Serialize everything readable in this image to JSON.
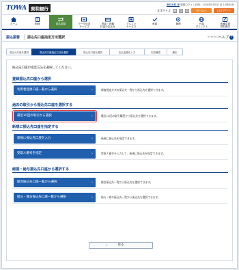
{
  "header": {
    "logo_mark": "TOWA",
    "bank_name": "東和銀行",
    "user_line": "東和太郎 様  前回ログイン日時：2016年05月11日 15時30分",
    "user_name": "東和太郎 様",
    "last_login": "前回ログイン日時：2016年05月11日 15時30分",
    "font_size_label": "文字サイズ",
    "font_sizes": [
      "小",
      "中",
      "大"
    ],
    "home_button": "ホームへ",
    "logout_button": "ログアウト"
  },
  "nav": {
    "items": [
      {
        "label": "ホーム",
        "icon": "home-icon"
      },
      {
        "label": "明細",
        "icon": "document-icon"
      },
      {
        "label": "振込振替",
        "icon": "transfer-icon",
        "active": true
      },
      {
        "label": "データ伝送\nサービス",
        "icon": "data-icon"
      },
      {
        "label": "税金・各種\n料金の払込み",
        "icon": "payment-icon"
      },
      {
        "label": "でんさい\nサービス",
        "icon": "densai-icon"
      },
      {
        "label": "承認",
        "icon": "approve-icon"
      },
      {
        "label": "管理",
        "icon": "manage-icon"
      },
      {
        "label": "外為\nダイレクト",
        "icon": "globe-icon"
      },
      {
        "label": "各種変更\n資料受付",
        "icon": "form-icon"
      }
    ]
  },
  "title": {
    "category": "振込振替",
    "main": "振込先口座指定方法選択",
    "code": "BFKF003",
    "help": "ヘルプ"
  },
  "steps": [
    "振込元口座を選択",
    "振込先口座指定方法を選択",
    "振込先口座を選択",
    "支払金額を入力",
    "内容確認",
    "確定"
  ],
  "intro": "振込先口座の指定方法を選択してください。",
  "sections": [
    {
      "title": "登録振込先口座から選択",
      "rows": [
        {
          "button": "利用者登録口座一覧から選択",
          "desc": "都度指定方式の振込先一覧から振込先を選択できます。"
        }
      ]
    },
    {
      "title": "過去の取引から振込先口座を選択する",
      "rows": [
        {
          "button": "最近10回の取引から選択",
          "desc": "最近10回の取引履歴から振込先を選択できます。"
        }
      ]
    },
    {
      "title": "新規に振込先口座を指定する",
      "rows": [
        {
          "button": "新規に振込先口座を入力",
          "desc": "新規に振込先を指定できます。"
        },
        {
          "button": "受取人番号を指定",
          "desc": "受取人番号を入力して、新規に振込先を指定できます。"
        }
      ]
    },
    {
      "title": "総振・給与振込先口座から選択する",
      "rows": [
        {
          "button": "総合振込先口座一覧から選択",
          "desc": "総合振込先一覧から振込先を選択できます。"
        },
        {
          "button": "給与・賞与振込先口座一覧から選択",
          "desc": "給与・賞与振込先一覧から振込先を選択できます。"
        }
      ]
    }
  ],
  "back_button": "戻る",
  "accent_color": "#0a3f8c",
  "button_color": "#1f5fae",
  "highlight_color": "#e53030"
}
